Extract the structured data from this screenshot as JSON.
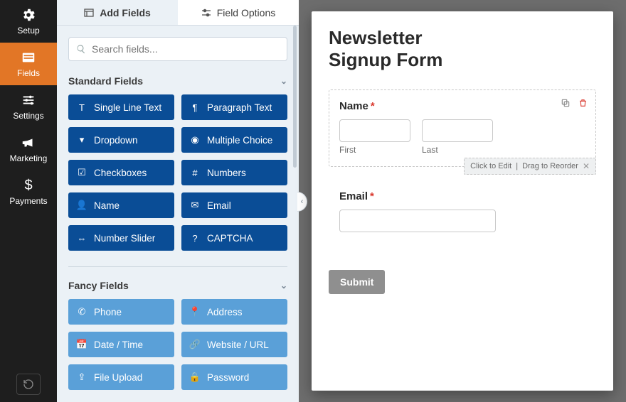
{
  "sidebar": {
    "items": [
      {
        "label": "Setup",
        "icon": "gear-icon"
      },
      {
        "label": "Fields",
        "icon": "form-icon",
        "active": true
      },
      {
        "label": "Settings",
        "icon": "sliders-icon"
      },
      {
        "label": "Marketing",
        "icon": "bullhorn-icon"
      },
      {
        "label": "Payments",
        "icon": "dollar-icon"
      }
    ],
    "bottom_icon": "history-icon"
  },
  "panel": {
    "tabs": [
      {
        "label": "Add Fields",
        "icon": "add-field-icon",
        "active": true
      },
      {
        "label": "Field Options",
        "icon": "options-icon"
      }
    ],
    "search_placeholder": "Search fields...",
    "groups": [
      {
        "title": "Standard Fields",
        "style": "std",
        "fields": [
          {
            "label": "Single Line Text",
            "icon": "text-icon"
          },
          {
            "label": "Paragraph Text",
            "icon": "paragraph-icon"
          },
          {
            "label": "Dropdown",
            "icon": "dropdown-icon"
          },
          {
            "label": "Multiple Choice",
            "icon": "radio-icon"
          },
          {
            "label": "Checkboxes",
            "icon": "check-icon"
          },
          {
            "label": "Numbers",
            "icon": "hash-icon"
          },
          {
            "label": "Name",
            "icon": "user-icon"
          },
          {
            "label": "Email",
            "icon": "mail-icon"
          },
          {
            "label": "Number Slider",
            "icon": "slider-icon"
          },
          {
            "label": "CAPTCHA",
            "icon": "captcha-icon"
          }
        ]
      },
      {
        "title": "Fancy Fields",
        "style": "fancy",
        "fields": [
          {
            "label": "Phone",
            "icon": "phone-icon"
          },
          {
            "label": "Address",
            "icon": "pin-icon"
          },
          {
            "label": "Date / Time",
            "icon": "calendar-icon"
          },
          {
            "label": "Website / URL",
            "icon": "link-icon"
          },
          {
            "label": "File Upload",
            "icon": "upload-icon"
          },
          {
            "label": "Password",
            "icon": "lock-icon"
          }
        ]
      }
    ]
  },
  "form": {
    "title_line1": "Newsletter",
    "title_line2": "Signup Form",
    "name_field": {
      "label": "Name",
      "required": true,
      "sub_first": "First",
      "sub_last": "Last",
      "hint_edit": "Click to Edit",
      "hint_drag": "Drag to Reorder"
    },
    "email_field": {
      "label": "Email",
      "required": true
    },
    "submit_label": "Submit"
  },
  "required_mark": "*",
  "hint_divider": "|"
}
